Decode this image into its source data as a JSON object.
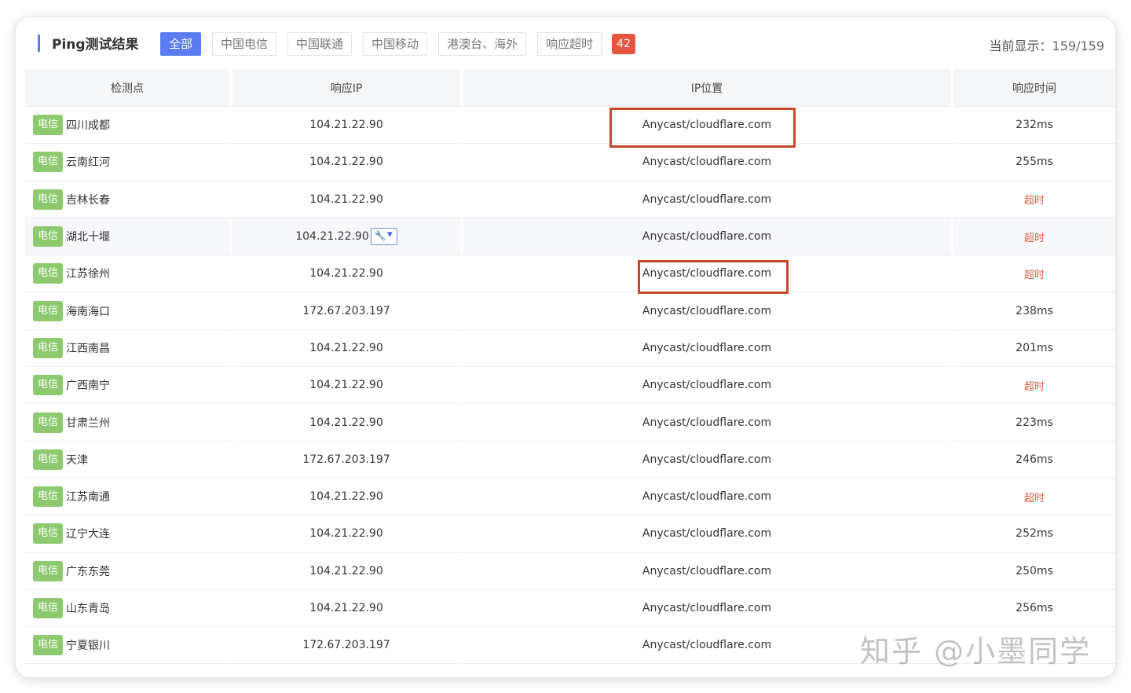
{
  "header": {
    "title": "Ping测试结果",
    "tabs": [
      {
        "label": "全部",
        "active": true
      },
      {
        "label": "中国电信",
        "active": false
      },
      {
        "label": "中国联通",
        "active": false
      },
      {
        "label": "中国移动",
        "active": false
      },
      {
        "label": "港澳台、海外",
        "active": false
      },
      {
        "label": "响应超时",
        "active": false
      }
    ],
    "timeout_count": "42",
    "current_label": "当前显示：",
    "current_value": "159/159"
  },
  "table": {
    "columns": [
      "检测点",
      "响应IP",
      "IP位置",
      "响应时间"
    ],
    "rows": [
      {
        "isp": "电信",
        "location": "四川成都",
        "ip": "104.21.22.90",
        "ip_location": "Anycast/cloudflare.com",
        "time": "232ms"
      },
      {
        "isp": "电信",
        "location": "云南红河",
        "ip": "104.21.22.90",
        "ip_location": "Anycast/cloudflare.com",
        "time": "255ms"
      },
      {
        "isp": "电信",
        "location": "吉林长春",
        "ip": "104.21.22.90",
        "ip_location": "Anycast/cloudflare.com",
        "time": "超时"
      },
      {
        "isp": "电信",
        "location": "湖北十堰",
        "ip": "104.21.22.90",
        "ip_location": "Anycast/cloudflare.com",
        "time": "超时"
      },
      {
        "isp": "电信",
        "location": "江苏徐州",
        "ip": "104.21.22.90",
        "ip_location": "Anycast/cloudflare.com",
        "time": "超时"
      },
      {
        "isp": "电信",
        "location": "海南海口",
        "ip": "172.67.203.197",
        "ip_location": "Anycast/cloudflare.com",
        "time": "238ms"
      },
      {
        "isp": "电信",
        "location": "江西南昌",
        "ip": "104.21.22.90",
        "ip_location": "Anycast/cloudflare.com",
        "time": "201ms"
      },
      {
        "isp": "电信",
        "location": "广西南宁",
        "ip": "104.21.22.90",
        "ip_location": "Anycast/cloudflare.com",
        "time": "超时"
      },
      {
        "isp": "电信",
        "location": "甘肃兰州",
        "ip": "104.21.22.90",
        "ip_location": "Anycast/cloudflare.com",
        "time": "223ms"
      },
      {
        "isp": "电信",
        "location": "天津",
        "ip": "172.67.203.197",
        "ip_location": "Anycast/cloudflare.com",
        "time": "246ms"
      },
      {
        "isp": "电信",
        "location": "江苏南通",
        "ip": "104.21.22.90",
        "ip_location": "Anycast/cloudflare.com",
        "time": "超时"
      },
      {
        "isp": "电信",
        "location": "辽宁大连",
        "ip": "104.21.22.90",
        "ip_location": "Anycast/cloudflare.com",
        "time": "252ms"
      },
      {
        "isp": "电信",
        "location": "广东东莞",
        "ip": "104.21.22.90",
        "ip_location": "Anycast/cloudflare.com",
        "time": "250ms"
      },
      {
        "isp": "电信",
        "location": "山东青岛",
        "ip": "104.21.22.90",
        "ip_location": "Anycast/cloudflare.com",
        "time": "256ms"
      },
      {
        "isp": "电信",
        "location": "宁夏银川",
        "ip": "172.67.203.197",
        "ip_location": "Anycast/cloudflare.com",
        "time": ""
      }
    ]
  },
  "watermark": "知乎 @小墨同学",
  "colors": {
    "accent": "#5b7cf0",
    "isp_badge": "#8dc96f",
    "timeout": "#e25b47",
    "highlight_box": "#c8472b"
  },
  "icons": {
    "tool_icon": "wrench-icon",
    "dropdown_icon": "caret-down-icon"
  }
}
